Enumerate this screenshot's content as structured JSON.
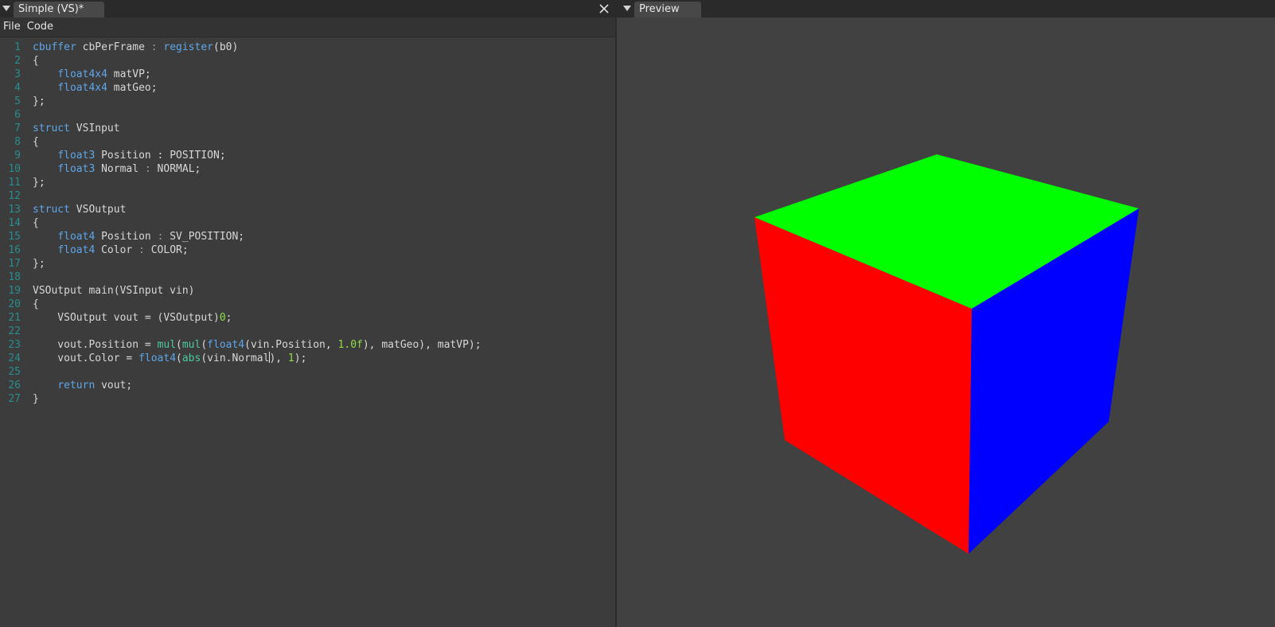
{
  "editor": {
    "tab_title": "Simple (VS)*",
    "menu": [
      "File",
      "Code"
    ],
    "lines": [
      [
        {
          "t": "cbuffer",
          "c": "kw"
        },
        {
          "t": " cbPerFrame "
        },
        {
          "t": ":",
          "c": "op"
        },
        {
          "t": " "
        },
        {
          "t": "register",
          "c": "kw"
        },
        {
          "t": "(b0)"
        }
      ],
      [
        {
          "t": "{"
        }
      ],
      [
        {
          "t": "    "
        },
        {
          "t": "float4x4",
          "c": "ty"
        },
        {
          "t": " matVP;"
        }
      ],
      [
        {
          "t": "    "
        },
        {
          "t": "float4x4",
          "c": "ty"
        },
        {
          "t": " matGeo;"
        }
      ],
      [
        {
          "t": "};"
        }
      ],
      [],
      [
        {
          "t": "struct",
          "c": "kw"
        },
        {
          "t": " VSInput"
        }
      ],
      [
        {
          "t": "{"
        }
      ],
      [
        {
          "t": "    "
        },
        {
          "t": "float3",
          "c": "ty"
        },
        {
          "t": " Position : POSITION;"
        }
      ],
      [
        {
          "t": "    "
        },
        {
          "t": "float3",
          "c": "ty"
        },
        {
          "t": " Normal "
        },
        {
          "t": ":",
          "c": "op"
        },
        {
          "t": " NORMAL;"
        }
      ],
      [
        {
          "t": "};"
        }
      ],
      [],
      [
        {
          "t": "struct",
          "c": "kw"
        },
        {
          "t": " VSOutput"
        }
      ],
      [
        {
          "t": "{"
        }
      ],
      [
        {
          "t": "    "
        },
        {
          "t": "float4",
          "c": "ty"
        },
        {
          "t": " Position "
        },
        {
          "t": ":",
          "c": "op"
        },
        {
          "t": " SV_POSITION;"
        }
      ],
      [
        {
          "t": "    "
        },
        {
          "t": "float4",
          "c": "ty"
        },
        {
          "t": " Color "
        },
        {
          "t": ":",
          "c": "op"
        },
        {
          "t": " COLOR;"
        }
      ],
      [
        {
          "t": "};"
        }
      ],
      [],
      [
        {
          "t": "VSOutput main(VSInput vin)"
        }
      ],
      [
        {
          "t": "{"
        }
      ],
      [
        {
          "t": "    VSOutput vout = (VSOutput)"
        },
        {
          "t": "0",
          "c": "num"
        },
        {
          "t": ";"
        }
      ],
      [],
      [
        {
          "t": "    vout.Position = "
        },
        {
          "t": "mul",
          "c": "fn"
        },
        {
          "t": "("
        },
        {
          "t": "mul",
          "c": "fn"
        },
        {
          "t": "("
        },
        {
          "t": "float4",
          "c": "ty"
        },
        {
          "t": "(vin.Position, "
        },
        {
          "t": "1.0f",
          "c": "num"
        },
        {
          "t": "), matGeo), matVP);"
        }
      ],
      [
        {
          "t": "    vout.Color = "
        },
        {
          "t": "float4",
          "c": "ty"
        },
        {
          "t": "("
        },
        {
          "t": "abs",
          "c": "fn"
        },
        {
          "t": "(vin.Normal"
        },
        {
          "cursor": true
        },
        {
          "t": "), "
        },
        {
          "t": "1",
          "c": "num"
        },
        {
          "t": ");"
        }
      ],
      [],
      [
        {
          "t": "    "
        },
        {
          "t": "return",
          "c": "kw"
        },
        {
          "t": " vout;"
        }
      ],
      [
        {
          "t": "}"
        }
      ]
    ]
  },
  "preview": {
    "tab_title": "Preview",
    "cube_colors": {
      "top": "#00ff00",
      "left": "#ff0000",
      "right": "#0000ff"
    },
    "background": "#414141"
  }
}
